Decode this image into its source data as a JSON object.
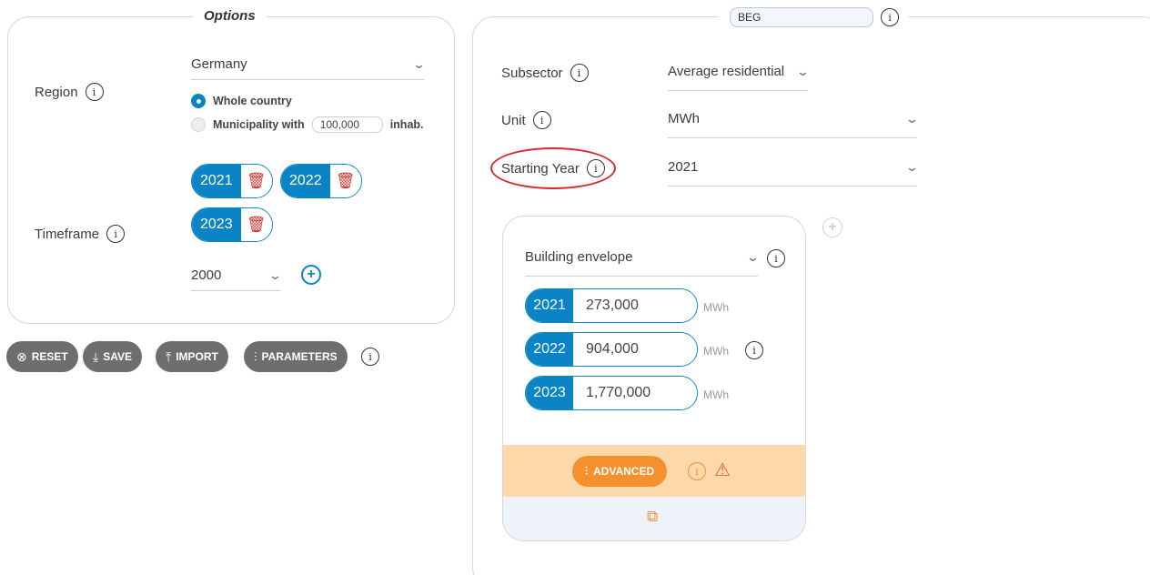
{
  "options": {
    "title": "Options",
    "region": {
      "label": "Region",
      "select_value": "Germany",
      "radio_whole": "Whole country",
      "radio_municipality_prefix": "Municipality with",
      "municipality_value": "100,000",
      "radio_municipality_suffix": "inhab."
    },
    "timeframe": {
      "label": "Timeframe",
      "years": [
        "2021",
        "2022",
        "2023"
      ],
      "add_select_value": "2000"
    }
  },
  "toolbar": {
    "reset": "RESET",
    "save": "SAVE",
    "import": "IMPORT",
    "parameters": "PARAMETERS"
  },
  "right": {
    "tag_value": "BEG",
    "subsector": {
      "label": "Subsector",
      "value": "Average residential"
    },
    "unit": {
      "label": "Unit",
      "value": "MWh"
    },
    "starting_year": {
      "label": "Starting Year",
      "value": "2021"
    },
    "card": {
      "category": "Building envelope",
      "rows": [
        {
          "year": "2021",
          "value": "273,000",
          "unit": "MWh"
        },
        {
          "year": "2022",
          "value": "904,000",
          "unit": "MWh"
        },
        {
          "year": "2023",
          "value": "1,770,000",
          "unit": "MWh"
        }
      ],
      "advanced": "ADVANCED"
    }
  },
  "colors": {
    "accent": "#0b84c6",
    "orange": "#f5902f",
    "danger": "#d32f2f"
  },
  "icons": [
    "info-icon",
    "chevron-down-icon",
    "trash-icon",
    "plus-circle-icon",
    "reset-icon",
    "download-icon",
    "upload-icon",
    "sliders-icon",
    "warning-icon",
    "copy-icon"
  ]
}
